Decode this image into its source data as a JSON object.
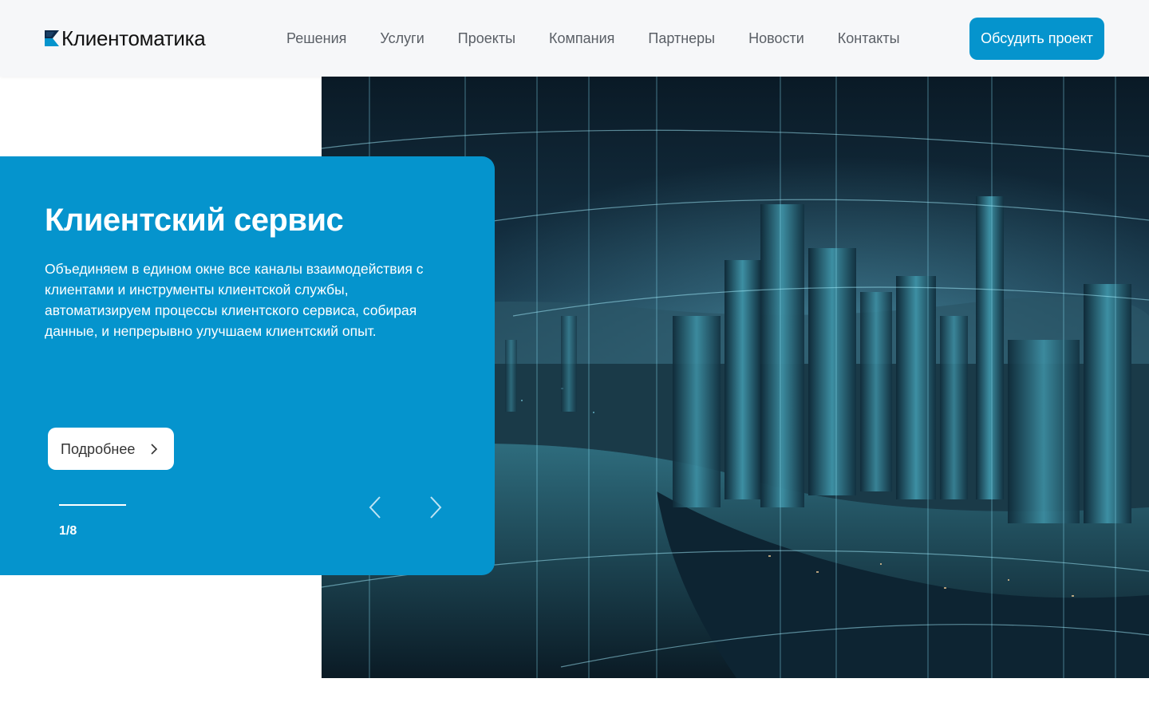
{
  "brand": {
    "name": "Клиентоматика",
    "icon": "logo-mark-icon"
  },
  "nav": {
    "items": [
      {
        "label": "Решения"
      },
      {
        "label": "Услуги"
      },
      {
        "label": "Проекты"
      },
      {
        "label": "Компания"
      },
      {
        "label": "Партнеры"
      },
      {
        "label": "Новости"
      },
      {
        "label": "Контакты"
      }
    ],
    "cta_label": "Обсудить проект"
  },
  "hero": {
    "title": "Клиентский сервис",
    "description": "Объединяем в едином окне все каналы взаимодействия с клиентами и инструменты клиентской службы, автоматизируем процессы клиентского сервиса, собирая данные, и непрерывно улучшаем клиентский опыт.",
    "more_label": "Подробнее",
    "counter": "1/8",
    "slide_progress": 0.125,
    "image": "futuristic-city-night-image"
  },
  "colors": {
    "accent": "#0594cd",
    "header_bg": "#f6f7f9",
    "nav_text": "#5a5f66"
  }
}
